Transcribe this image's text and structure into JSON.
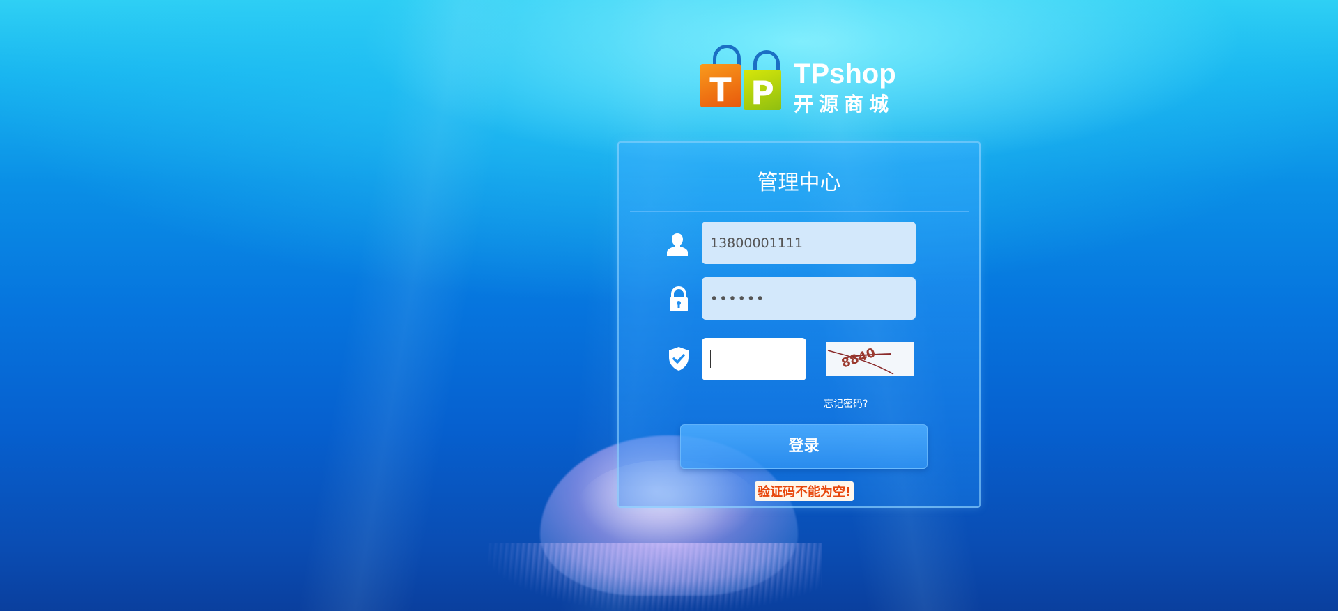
{
  "brand": {
    "logo_letters": [
      "T",
      "P"
    ],
    "name_en": "TPshop",
    "name_cn": "开源商城"
  },
  "panel": {
    "title": "管理中心"
  },
  "form": {
    "username": {
      "icon": "user-icon",
      "value": "13800001111"
    },
    "password": {
      "icon": "lock-icon",
      "value": "••••••"
    },
    "captcha": {
      "icon": "shield-check-icon",
      "value": ""
    },
    "captcha_image_text": "8840"
  },
  "links": {
    "forgot_password": "忘记密码?"
  },
  "buttons": {
    "login": "登录"
  },
  "messages": {
    "error": "验证码不能为空!"
  },
  "colors": {
    "panel_border": "#a0dcff",
    "field_bg": "#d3e8fb",
    "error_text": "#e8470c",
    "logo_orange": "#f08a1a",
    "logo_green": "#b8d40c",
    "logo_handle": "#1b6fc4"
  }
}
